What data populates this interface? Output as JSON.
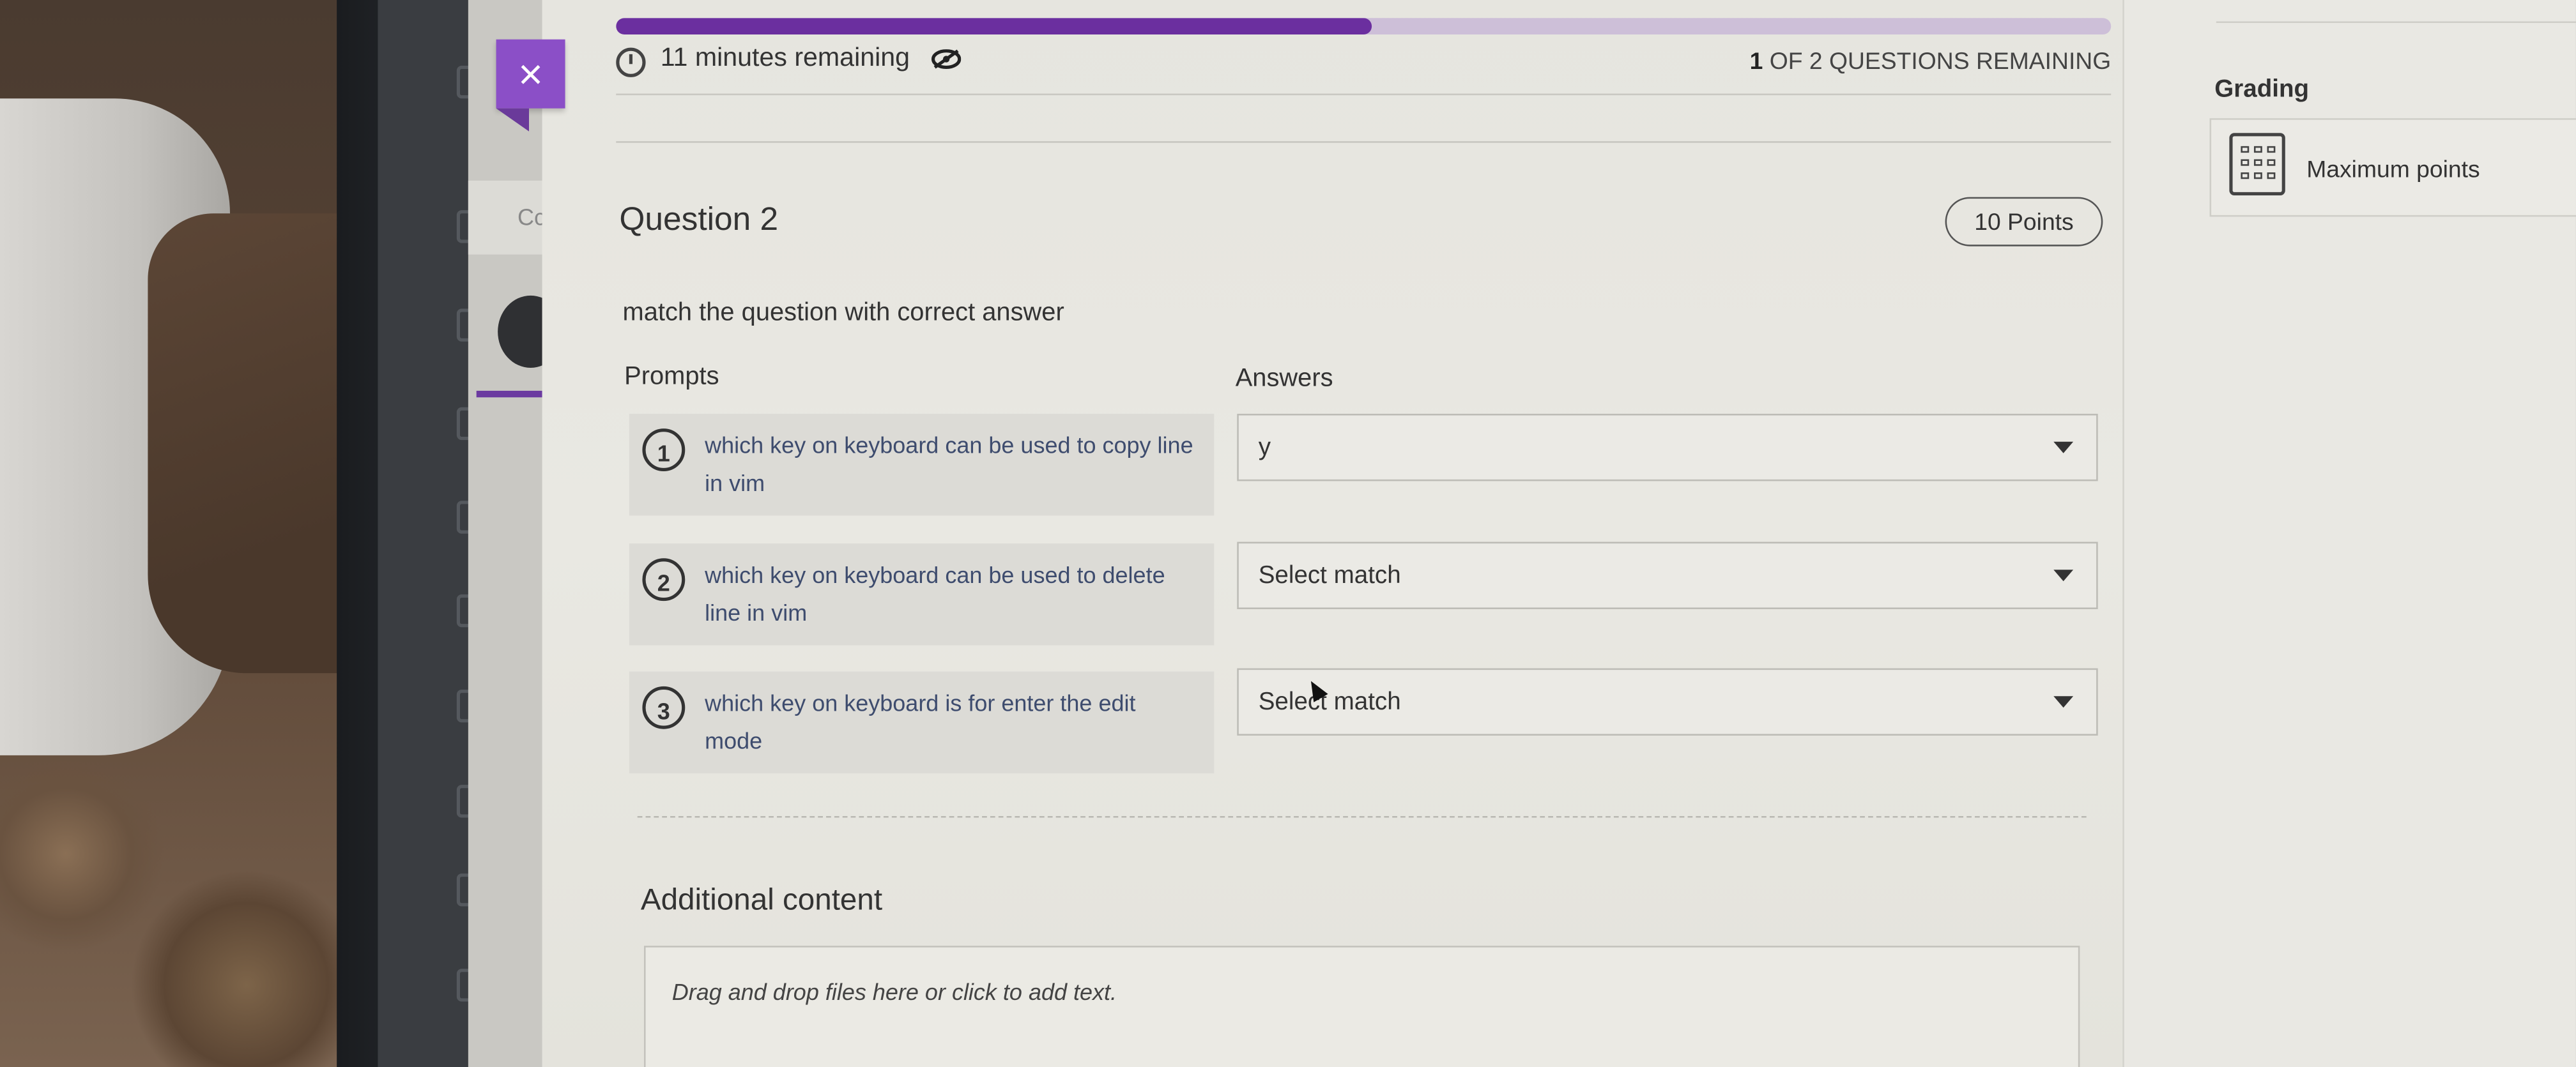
{
  "header": {
    "close_label": "×",
    "progress": 0.505,
    "timer_text": "11 minutes remaining",
    "questions_remaining_count": "1",
    "questions_remaining_text": " OF 2 QUESTIONS REMAINING"
  },
  "question": {
    "title": "Question 2",
    "points": "10 Points",
    "instruction": "match the question with correct answer",
    "prompts_header": "Prompts",
    "answers_header": "Answers",
    "items": [
      {
        "number": "1",
        "prompt": "which key on keyboard can be used to copy line in vim",
        "answer": "y"
      },
      {
        "number": "2",
        "prompt": "which key on keyboard can be used to delete line in vim",
        "answer": "Select match"
      },
      {
        "number": "3",
        "prompt": "which key on keyboard is for enter the edit mode",
        "answer": "Select match"
      }
    ]
  },
  "additional": {
    "title": "Additional content",
    "dropzone_text": "Drag and drop files here or click to add text."
  },
  "sidebar": {
    "course_tab_label": "Cc"
  },
  "grading": {
    "title": "Grading",
    "max_points_label": "Maximum points"
  },
  "colors": {
    "accent": "#6b2f9f",
    "close_bg": "#8b4fc7"
  }
}
